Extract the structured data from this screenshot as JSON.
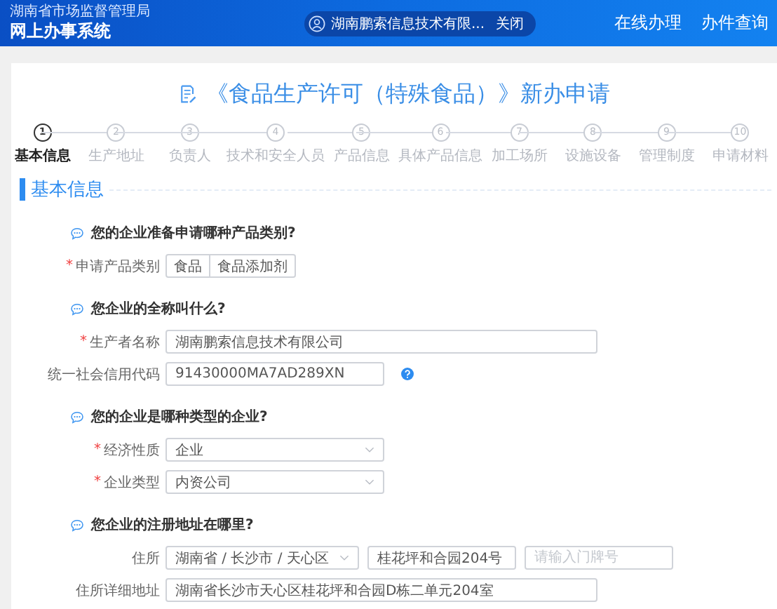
{
  "header": {
    "org": "湖南省市场监督管理局",
    "system": "网上办事系统",
    "user": {
      "name": "湖南鹏索信息技术有限...",
      "close": "关闭"
    },
    "nav": [
      "在线办理",
      "办件查询"
    ]
  },
  "title": "《食品生产许可（特殊食品）》新办申请",
  "steps": [
    {
      "number": "1",
      "label": "基本信息",
      "selected": true
    },
    {
      "number": "2",
      "label": "生产地址",
      "selected": false
    },
    {
      "number": "3",
      "label": "负责人",
      "selected": false
    },
    {
      "number": "4",
      "label": "技术和安全人员",
      "selected": false
    },
    {
      "number": "5",
      "label": "产品信息",
      "selected": false
    },
    {
      "number": "6",
      "label": "具体产品信息",
      "selected": false
    },
    {
      "number": "7",
      "label": "加工场所",
      "selected": false
    },
    {
      "number": "8",
      "label": "设施设备",
      "selected": false
    },
    {
      "number": "9",
      "label": "管理制度",
      "selected": false
    },
    {
      "number": "10",
      "label": "申请材料",
      "selected": false
    }
  ],
  "section_title": "基本信息",
  "questions": [
    {
      "question": "您的企业准备申请哪种产品类别?",
      "fields": [
        {
          "required_mark": "*",
          "label": "申请产品类别",
          "controls": [
            {
              "kind": "segmented",
              "options": [
                {
                  "label": "食品",
                  "selected": false
                },
                {
                  "label": "食品添加剂",
                  "selected": false
                }
              ]
            }
          ]
        }
      ]
    },
    {
      "question": "您企业的全称叫什么?",
      "fields": [
        {
          "required_mark": "*",
          "label": "生产者名称",
          "controls": [
            {
              "kind": "long-input",
              "value": "湖南鹏索信息技术有限公司"
            }
          ]
        },
        {
          "label": "统一社会信用代码",
          "help": true,
          "controls": [
            {
              "kind": "input",
              "value": "91430000MA7AD289XN"
            }
          ]
        }
      ]
    },
    {
      "question": "您的企业是哪种类型的企业?",
      "fields": [
        {
          "required_mark": "*",
          "label": "经济性质",
          "controls": [
            {
              "kind": "select",
              "value": "企业"
            }
          ]
        },
        {
          "required_mark": "*",
          "label": "企业类型",
          "controls": [
            {
              "kind": "select",
              "value": "内资公司"
            }
          ]
        }
      ]
    },
    {
      "question": "您企业的注册地址在哪里?",
      "fields": [
        {
          "label": "住所",
          "controls": [
            {
              "kind": "cascader",
              "value": "湖南省 / 长沙市 / 天心区"
            },
            {
              "kind": "short-input",
              "value": "桂花坪和合园204号"
            },
            {
              "kind": "short-input",
              "placeholder": "请输入门牌号"
            }
          ]
        },
        {
          "label": "住所详细地址",
          "controls": [
            {
              "kind": "long-input",
              "value": "湖南省长沙市天心区桂花坪和合园D栋二单元204室"
            }
          ]
        }
      ]
    }
  ]
}
